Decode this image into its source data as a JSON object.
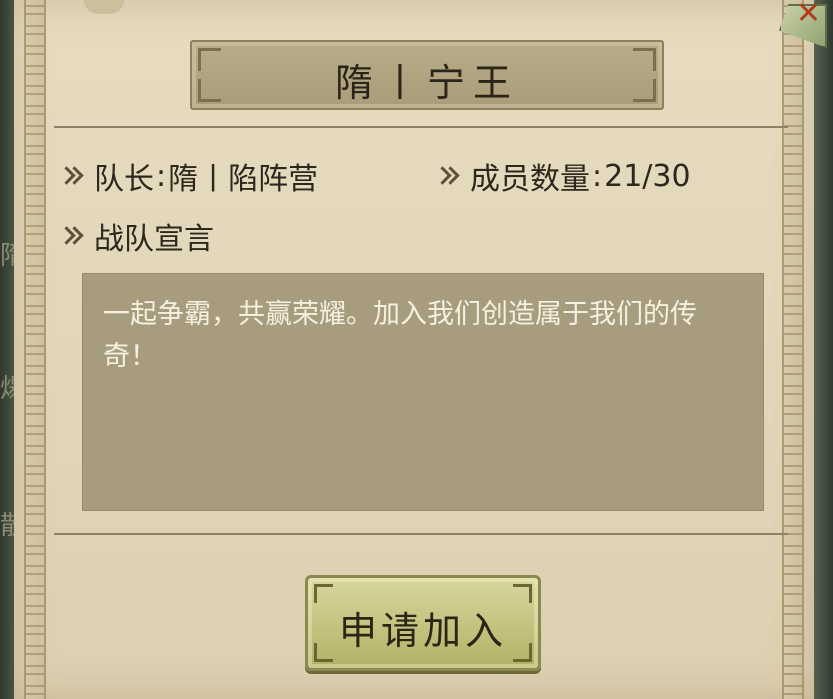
{
  "team": {
    "name": "隋丨宁王",
    "captain_label": "队长",
    "captain_name": "隋丨陷阵营",
    "members_label": "成员数量",
    "members_count": "21/30",
    "manifesto_label": "战队宣言",
    "manifesto_text": "一起争霸，共赢荣耀。加入我们创造属于我们的传奇！"
  },
  "actions": {
    "join_label": "申请加入",
    "close_icon": "close-icon"
  },
  "background": {
    "peek_chars": [
      "隋",
      "煬",
      "散"
    ]
  },
  "colors": {
    "parchment": "#e2d6b9",
    "manifesto_box": "#a89c7e",
    "button": "#c4c27e",
    "close_x": "#b03a1c"
  }
}
